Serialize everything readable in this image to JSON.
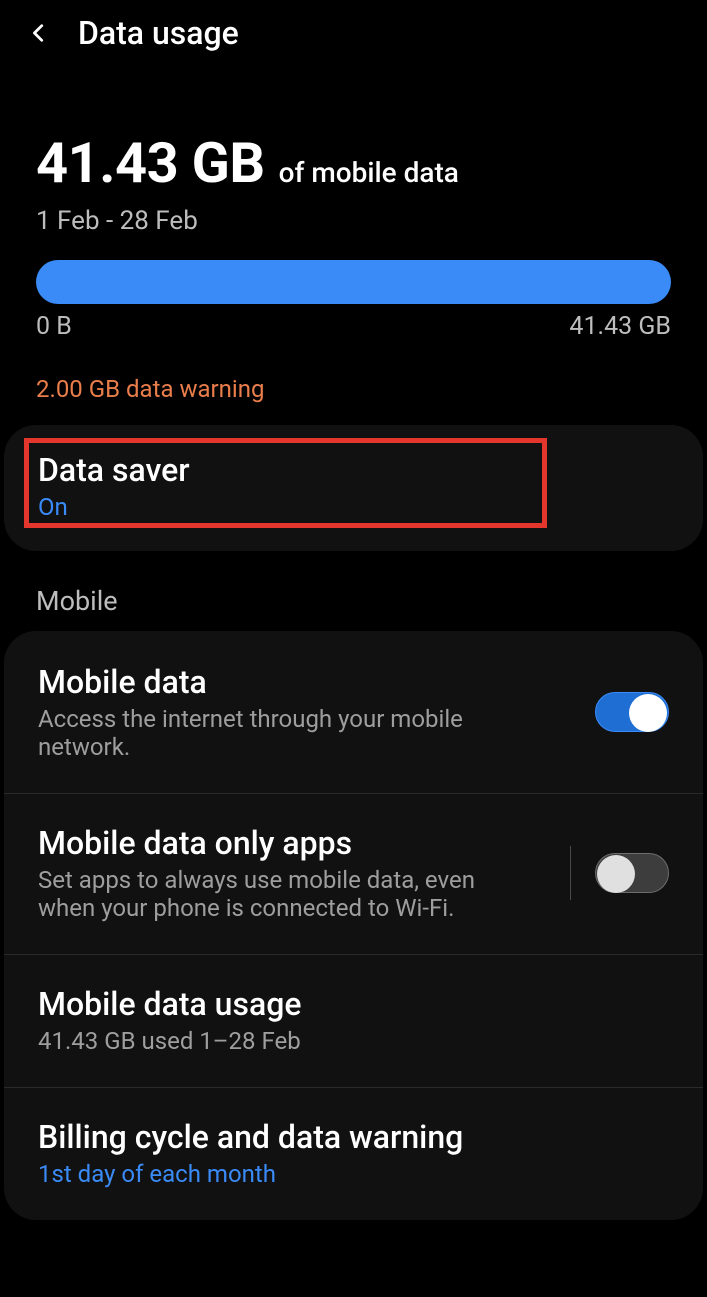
{
  "header": {
    "title": "Data usage"
  },
  "summary": {
    "used": "41.43 GB",
    "of_label": "of mobile data",
    "period": "1 Feb - 28 Feb",
    "bar_min": "0 B",
    "bar_max": "41.43 GB"
  },
  "warning": "2.00 GB data warning",
  "data_saver": {
    "title": "Data saver",
    "status": "On"
  },
  "section_mobile": "Mobile",
  "rows": {
    "mobile_data": {
      "title": "Mobile data",
      "sub": "Access the internet through your mobile network.",
      "on": true
    },
    "only_apps": {
      "title": "Mobile data only apps",
      "sub": "Set apps to always use mobile data, even when your phone is connected to Wi-Fi.",
      "on": false
    },
    "usage": {
      "title": "Mobile data usage",
      "sub": "41.43 GB used 1–28 Feb"
    },
    "billing": {
      "title": "Billing cycle and data warning",
      "sub": "1st day of each month"
    }
  }
}
